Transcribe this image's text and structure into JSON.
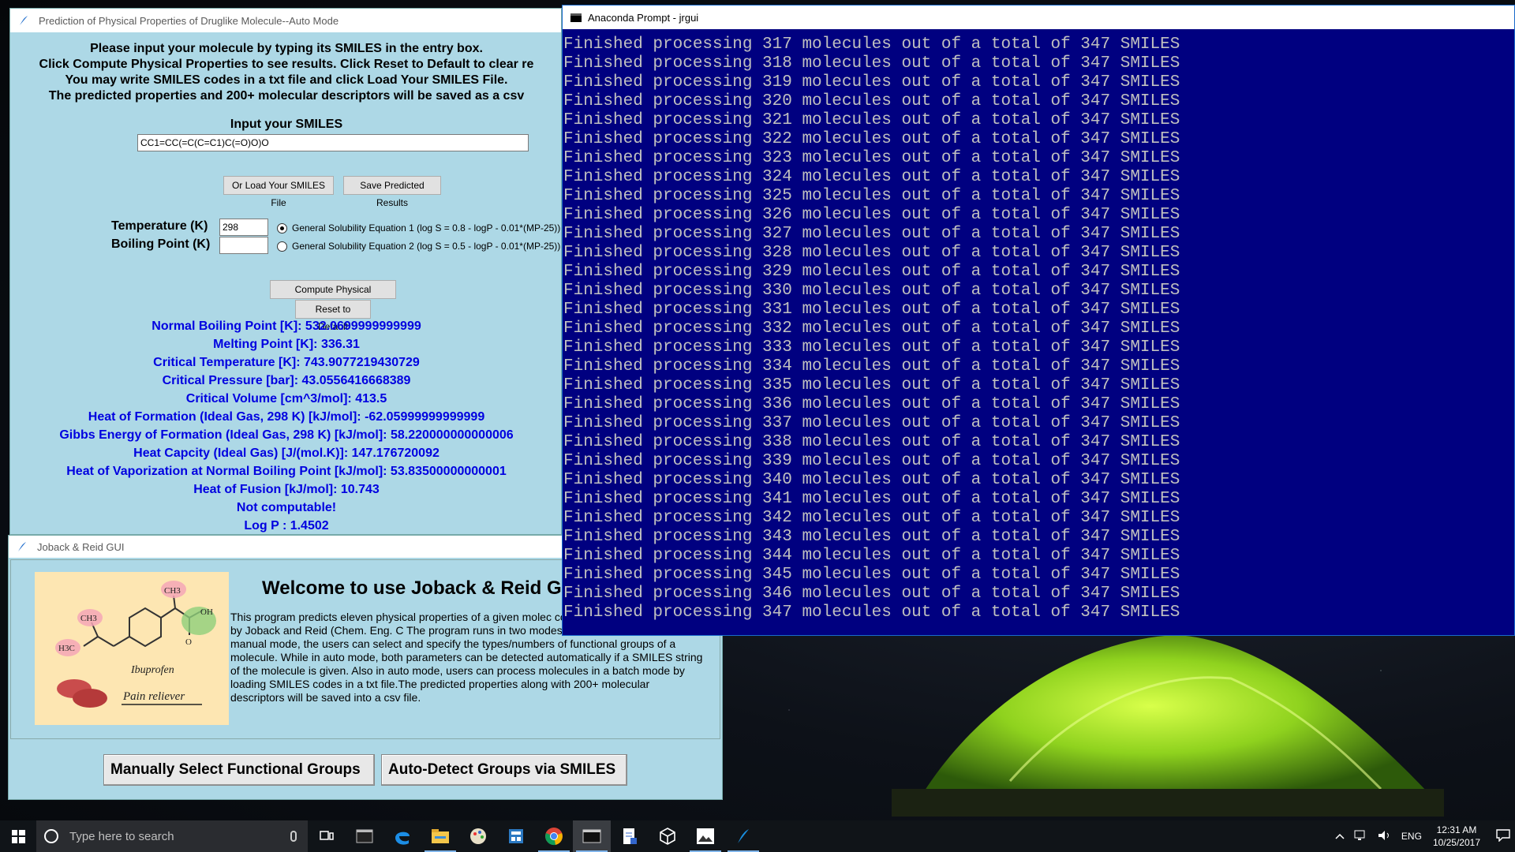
{
  "auto_window": {
    "title": "Prediction of Physical Properties of Druglike Molecule--Auto Mode",
    "instructions": [
      "Please input your molecule by typing its SMILES in the entry box.",
      "Click Compute Physical Properties to see results. Click Reset to Default to clear re",
      "You may write SMILES codes in a txt file and click Load Your SMILES File.",
      "The predicted properties and 200+ molecular descriptors will be saved as a csv"
    ],
    "input_label": "Input your SMILES",
    "smiles_value": "CC1=CC(=C(C=C1)C(=O)O)O",
    "load_button": "Or Load Your SMILES File",
    "save_button": "Save Predicted Results",
    "temperature_label": "Temperature (K)",
    "temperature_value": "298",
    "boiling_label": "Boiling Point (K)",
    "boiling_value": "",
    "gse1": "General Solubility Equation 1 (log S = 0.8 - logP - 0.01*(MP-25))",
    "gse2": "General Solubility Equation 2 (log S = 0.5 - logP - 0.01*(MP-25))",
    "compute_button": "Compute Physical Properties",
    "reset_button": "Reset to Default",
    "results": [
      "Normal Boiling Point [K]: 532.0699999999999",
      "Melting Point [K]: 336.31",
      "Critical Temperature [K]: 743.9077219430729",
      "Critical Pressure [bar]: 43.0556416668389",
      "Critical Volume [cm^3/mol]: 413.5",
      "Heat of Formation (Ideal Gas, 298 K) [kJ/mol]: -62.05999999999999",
      "Gibbs Energy of Formation (Ideal Gas, 298 K) [kJ/mol]: 58.220000000000006",
      "Heat Capcity (Ideal Gas) [J/(mol.K)]: 147.176720092",
      "Heat of Vaporization at Normal Boiling Point [kJ/mol]: 53.83500000000001",
      "Heat of Fusion [kJ/mol]: 10.743",
      "Not computable!",
      "Log P : 1.4502"
    ]
  },
  "jr_window": {
    "title": "Joback & Reid GUI",
    "welcome": "Welcome to use Joback & Reid G",
    "logo": {
      "ch3_top": "CH3",
      "ch3_left": "CH3",
      "h3c": "H3C",
      "oh": "OH",
      "o": "O",
      "name": "Ibuprofen",
      "caption": "Pain reliever"
    },
    "description": "This program predicts eleven physical properties of a given molec contribution method proposed by Joback and Reid (Chem. Eng. C The program runs in two modes--manual and auto modes. In manual mode, the users can select and specify the types/numbers of functional groups of a molecule. While in auto mode, both parameters can be detected automatically if a SMILES string of the molecule is given. Also in auto mode, users can process molecules in a batch mode by loading SMILES codes in a txt file.The predicted properties along with 200+ molecular descriptors will be saved into a csv file.",
    "manual_button": "Manually Select Functional Groups",
    "auto_button": "Auto-Detect Groups via SMILES"
  },
  "prompt_window": {
    "title": "Anaconda Prompt - jrgui",
    "lines": [
      "Finished processing 317 molecules out of a total of 347 SMILES",
      "Finished processing 318 molecules out of a total of 347 SMILES",
      "Finished processing 319 molecules out of a total of 347 SMILES",
      "Finished processing 320 molecules out of a total of 347 SMILES",
      "Finished processing 321 molecules out of a total of 347 SMILES",
      "Finished processing 322 molecules out of a total of 347 SMILES",
      "Finished processing 323 molecules out of a total of 347 SMILES",
      "Finished processing 324 molecules out of a total of 347 SMILES",
      "Finished processing 325 molecules out of a total of 347 SMILES",
      "Finished processing 326 molecules out of a total of 347 SMILES",
      "Finished processing 327 molecules out of a total of 347 SMILES",
      "Finished processing 328 molecules out of a total of 347 SMILES",
      "Finished processing 329 molecules out of a total of 347 SMILES",
      "Finished processing 330 molecules out of a total of 347 SMILES",
      "Finished processing 331 molecules out of a total of 347 SMILES",
      "Finished processing 332 molecules out of a total of 347 SMILES",
      "Finished processing 333 molecules out of a total of 347 SMILES",
      "Finished processing 334 molecules out of a total of 347 SMILES",
      "Finished processing 335 molecules out of a total of 347 SMILES",
      "Finished processing 336 molecules out of a total of 347 SMILES",
      "Finished processing 337 molecules out of a total of 347 SMILES",
      "Finished processing 338 molecules out of a total of 347 SMILES",
      "Finished processing 339 molecules out of a total of 347 SMILES",
      "Finished processing 340 molecules out of a total of 347 SMILES",
      "Finished processing 341 molecules out of a total of 347 SMILES",
      "Finished processing 342 molecules out of a total of 347 SMILES",
      "Finished processing 343 molecules out of a total of 347 SMILES",
      "Finished processing 344 molecules out of a total of 347 SMILES",
      "Finished processing 345 molecules out of a total of 347 SMILES",
      "Finished processing 346 molecules out of a total of 347 SMILES",
      "Finished processing 347 molecules out of a total of 347 SMILES"
    ]
  },
  "taskbar": {
    "search_placeholder": "Type here to search",
    "lang": "ENG",
    "time": "12:31 AM",
    "date": "10/25/2017",
    "icons": [
      "task-view-icon",
      "cmd-icon",
      "edge-icon",
      "file-explorer-icon",
      "paint-icon",
      "calculator-icon",
      "chrome-icon",
      "anaconda-prompt-icon",
      "notepad-icon",
      "cube-icon",
      "photos-icon",
      "python-feather-icon"
    ]
  },
  "colors": {
    "tk_background": "#add8e6",
    "result_text": "#0000e0",
    "console_background": "#000080",
    "console_text": "#c0c0c0"
  }
}
